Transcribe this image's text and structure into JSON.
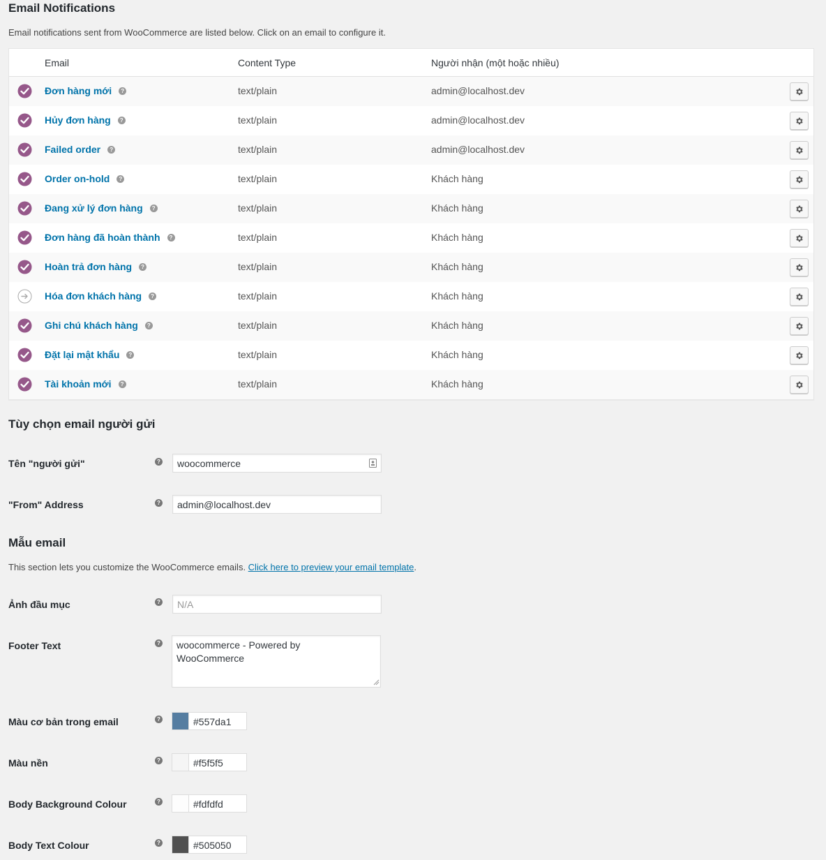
{
  "header": {
    "title": "Email Notifications",
    "description": "Email notifications sent from WooCommerce are listed below. Click on an email to configure it."
  },
  "table": {
    "columns": [
      "Email",
      "Content Type",
      "Người nhận (một hoặc nhiều)"
    ],
    "rows": [
      {
        "name": "Đơn hàng mới",
        "content_type": "text/plain",
        "recipient": "admin@localhost.dev",
        "enabled": true
      },
      {
        "name": "Hủy đơn hàng",
        "content_type": "text/plain",
        "recipient": "admin@localhost.dev",
        "enabled": true
      },
      {
        "name": "Failed order",
        "content_type": "text/plain",
        "recipient": "admin@localhost.dev",
        "enabled": true
      },
      {
        "name": "Order on-hold",
        "content_type": "text/plain",
        "recipient": "Khách hàng",
        "enabled": true
      },
      {
        "name": "Đang xử lý đơn hàng",
        "content_type": "text/plain",
        "recipient": "Khách hàng",
        "enabled": true
      },
      {
        "name": "Đơn hàng đã hoàn thành",
        "content_type": "text/plain",
        "recipient": "Khách hàng",
        "enabled": true
      },
      {
        "name": "Hoàn trả đơn hàng",
        "content_type": "text/plain",
        "recipient": "Khách hàng",
        "enabled": true
      },
      {
        "name": "Hóa đơn khách hàng",
        "content_type": "text/plain",
        "recipient": "Khách hàng",
        "enabled": false
      },
      {
        "name": "Ghi chú khách hàng",
        "content_type": "text/plain",
        "recipient": "Khách hàng",
        "enabled": true
      },
      {
        "name": "Đặt lại mật khẩu",
        "content_type": "text/plain",
        "recipient": "Khách hàng",
        "enabled": true
      },
      {
        "name": "Tài khoản mới",
        "content_type": "text/plain",
        "recipient": "Khách hàng",
        "enabled": true
      }
    ]
  },
  "sender": {
    "title": "Tùy chọn email người gửi",
    "from_name_label": "Tên \"người gửi\"",
    "from_name_value": "woocommerce",
    "from_address_label": "\"From\" Address",
    "from_address_value": "admin@localhost.dev"
  },
  "template": {
    "title": "Mẫu email",
    "description": "This section lets you customize the WooCommerce emails. ",
    "preview_link": "Click here to preview your email template",
    "after_link": ".",
    "header_image_label": "Ảnh đầu mục",
    "header_image_placeholder": "N/A",
    "footer_text_label": "Footer Text",
    "footer_text_value": "woocommerce - Powered by\nWooCommerce",
    "colors": [
      {
        "label": "Màu cơ bản trong email",
        "value": "#557da1"
      },
      {
        "label": "Màu nền",
        "value": "#f5f5f5"
      },
      {
        "label": "Body Background Colour",
        "value": "#fdfdfd"
      },
      {
        "label": "Body Text Colour",
        "value": "#505050"
      }
    ]
  },
  "accent": {
    "enabled_icon_color": "#96588a",
    "link_color": "#0073aa"
  }
}
